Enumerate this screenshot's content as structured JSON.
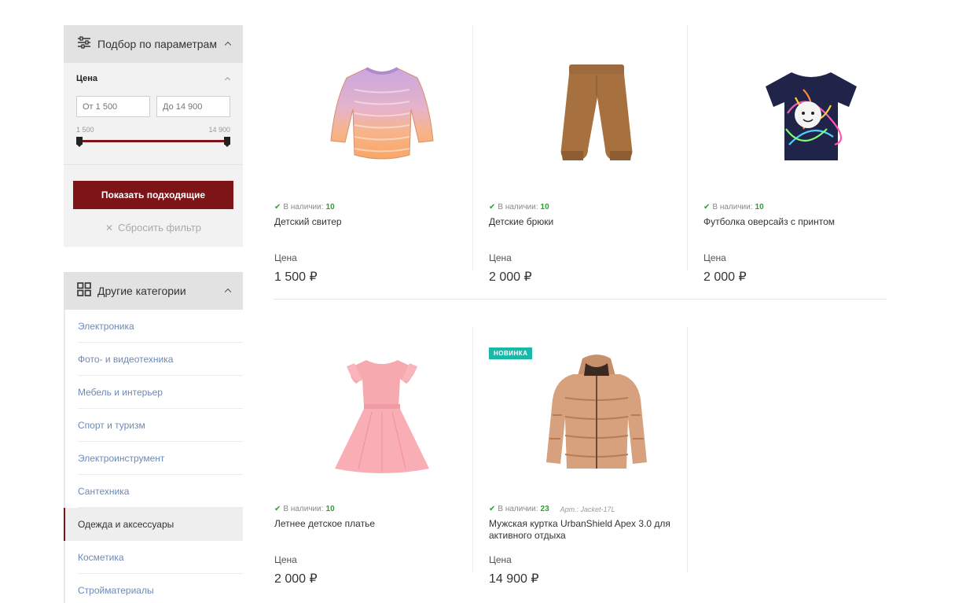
{
  "filter": {
    "title": "Подбор по параметрам",
    "price_title": "Цена",
    "from_placeholder": "От 1 500",
    "to_placeholder": "До 14 900",
    "min_label": "1 500",
    "max_label": "14 900",
    "show_button": "Показать подходящие",
    "reset_label": "Сбросить фильтр"
  },
  "categories": {
    "title": "Другие категории",
    "items": [
      {
        "label": "Электроника"
      },
      {
        "label": "Фото- и видеотехника"
      },
      {
        "label": "Мебель и интерьер"
      },
      {
        "label": "Спорт и туризм"
      },
      {
        "label": "Электроинструмент"
      },
      {
        "label": "Сантехника"
      },
      {
        "label": "Одежда и аксессуары",
        "active": true
      },
      {
        "label": "Косметика"
      },
      {
        "label": "Стройматериалы"
      }
    ]
  },
  "products": [
    {
      "name": "Детский свитер",
      "stock_label": "В наличии:",
      "stock": "10",
      "price_label": "Цена",
      "price": "1 500 ₽",
      "icon": "sweater-image"
    },
    {
      "name": "Детские брюки",
      "stock_label": "В наличии:",
      "stock": "10",
      "price_label": "Цена",
      "price": "2 000 ₽",
      "icon": "pants-image"
    },
    {
      "name": "Футболка оверсайз с принтом",
      "stock_label": "В наличии:",
      "stock": "10",
      "price_label": "Цена",
      "price": "2 000 ₽",
      "icon": "tshirt-image"
    },
    {
      "name": "Летнее детское платье",
      "stock_label": "В наличии:",
      "stock": "10",
      "price_label": "Цена",
      "price": "2 000 ₽",
      "icon": "dress-image"
    },
    {
      "name": "Мужская куртка UrbanShield Apex 3.0 для активного отдыха",
      "stock_label": "В наличии:",
      "stock": "23",
      "article": "Арт.: Jacket-17L",
      "badge": "НОВИНКА",
      "price_label": "Цена",
      "price": "14 900 ₽",
      "icon": "jacket-image"
    }
  ],
  "colors": {
    "accent": "#7d1418",
    "in_stock": "#2aa12c",
    "badge": "#1ab8a7",
    "category_link": "#6c89b8"
  }
}
